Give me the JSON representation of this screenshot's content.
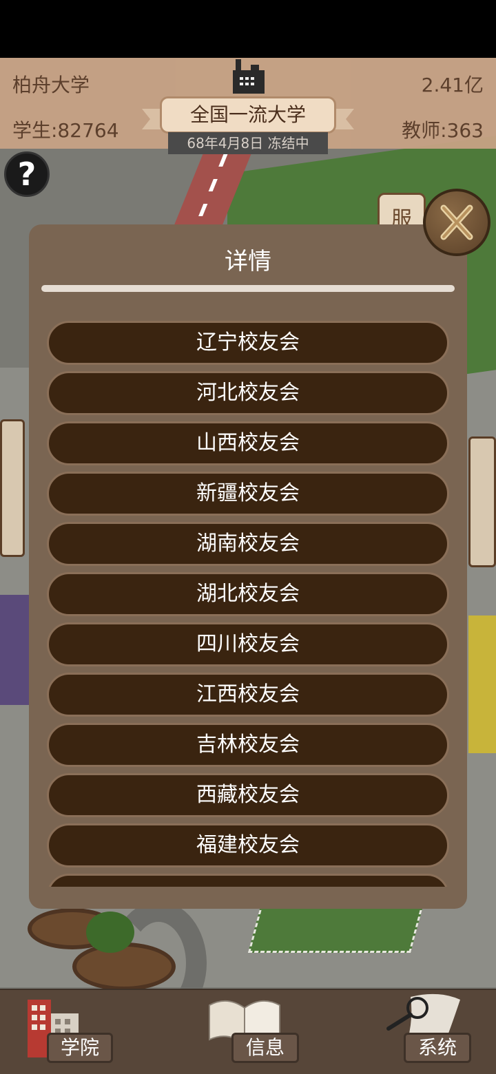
{
  "hud": {
    "university_name": "柏舟大学",
    "money": "2.41亿",
    "students": "学生:82764",
    "teachers": "教师:363",
    "rank_title": "全国一流大学",
    "date_status": "68年4月8日 冻结中"
  },
  "help": {
    "label": "?"
  },
  "map": {
    "sign_text": "服"
  },
  "dialog": {
    "title": "详情",
    "items": [
      "辽宁校友会",
      "河北校友会",
      "山西校友会",
      "新疆校友会",
      "湖南校友会",
      "湖北校友会",
      "四川校友会",
      "江西校友会",
      "吉林校友会",
      "西藏校友会",
      "福建校友会",
      ""
    ]
  },
  "nav": {
    "college": "学院",
    "info": "信息",
    "system": "系统"
  },
  "colors": {
    "dialog_bg": "#7a6552",
    "item_bg": "#3a2410",
    "hud_bg": "#caa486",
    "bottombar_bg": "#574639"
  },
  "icons": [
    "help-icon",
    "factory-icon",
    "close-icon",
    "college-building-icon",
    "book-icon",
    "magnifier-icon"
  ]
}
